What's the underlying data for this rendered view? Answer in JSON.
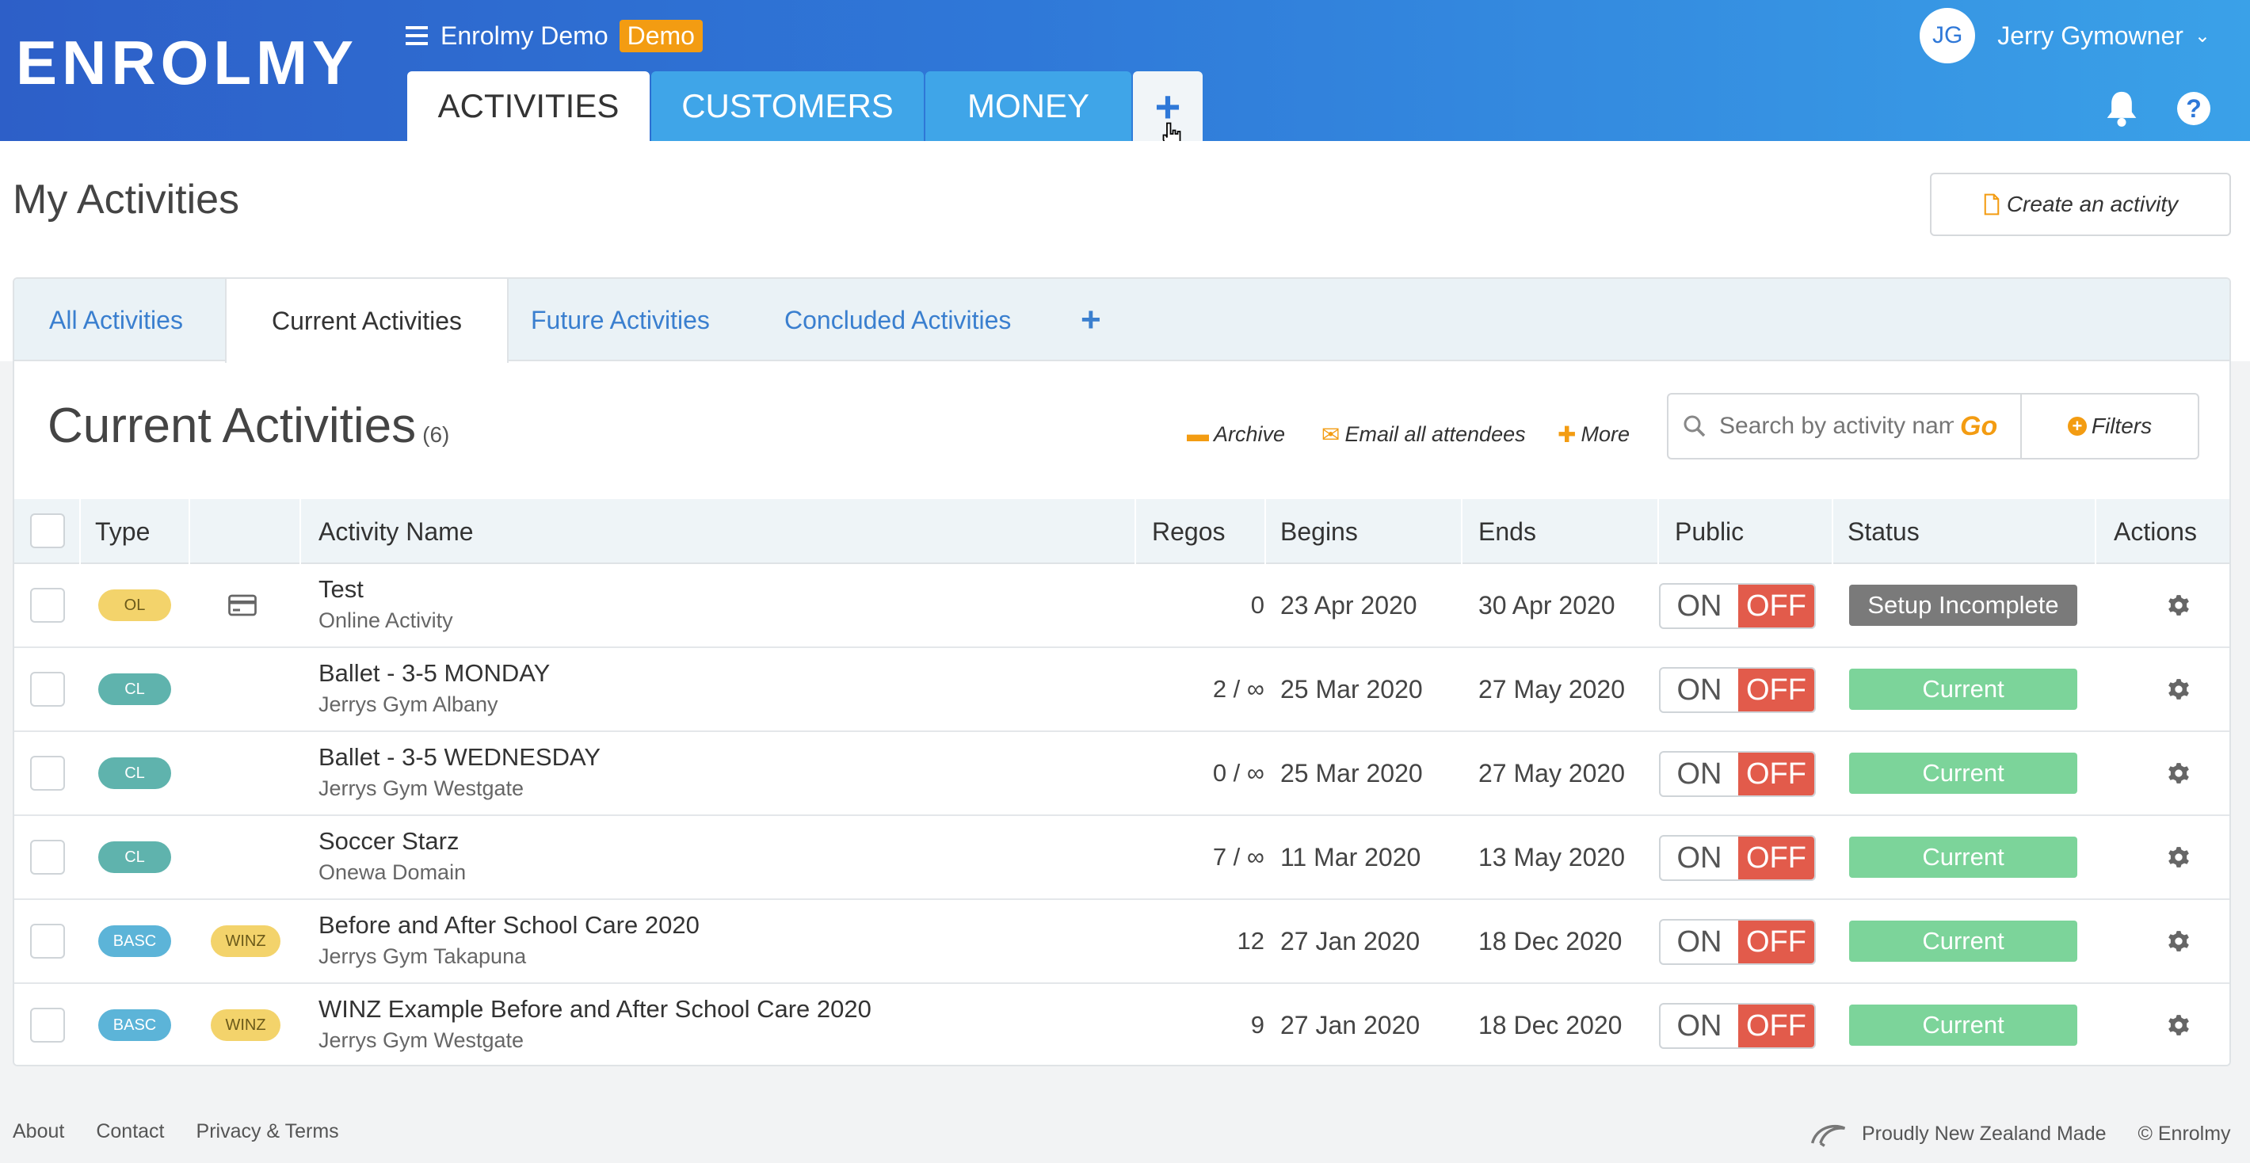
{
  "header": {
    "logo_text": "ENROLMY",
    "org_name": "Enrolmy Demo",
    "org_badge": "Demo",
    "tabs": [
      {
        "label": "ACTIVITIES"
      },
      {
        "label": "CUSTOMERS"
      },
      {
        "label": "MONEY"
      },
      {
        "label": "+"
      }
    ],
    "user": {
      "initials": "JG",
      "name": "Jerry Gymowner"
    },
    "help_label": "?"
  },
  "page": {
    "title": "My Activities",
    "create_button": "Create an activity"
  },
  "sub_tabs": [
    {
      "label": "All Activities"
    },
    {
      "label": "Current Activities"
    },
    {
      "label": "Future Activities"
    },
    {
      "label": "Concluded Activities"
    },
    {
      "label": "+"
    }
  ],
  "section": {
    "title": "Current Activities",
    "count": "(6)",
    "archive": "Archive",
    "email": "Email all attendees",
    "more": "More",
    "search_placeholder": "Search by activity name",
    "go": "Go",
    "filters": "Filters"
  },
  "table": {
    "headers": [
      "Type",
      "Activity Name",
      "Regos",
      "Begins",
      "Ends",
      "Public",
      "Status",
      "Actions"
    ],
    "rows": [
      {
        "type": "OL",
        "winz": "",
        "name": "Test",
        "location": "Online Activity",
        "regos": "0",
        "begins": "23 Apr 2020",
        "ends": "30 Apr 2020",
        "on": "ON",
        "off": "OFF",
        "status": "Setup Incomplete"
      },
      {
        "type": "CL",
        "winz": "",
        "name": "Ballet - 3-5 MONDAY",
        "location": "Jerrys Gym Albany",
        "regos": "2 / ∞",
        "begins": "25 Mar 2020",
        "ends": "27 May 2020",
        "on": "ON",
        "off": "OFF",
        "status": "Current"
      },
      {
        "type": "CL",
        "winz": "",
        "name": "Ballet - 3-5 WEDNESDAY",
        "location": "Jerrys Gym Westgate",
        "regos": "0 / ∞",
        "begins": "25 Mar 2020",
        "ends": "27 May 2020",
        "on": "ON",
        "off": "OFF",
        "status": "Current"
      },
      {
        "type": "CL",
        "winz": "",
        "name": "Soccer Starz",
        "location": "Onewa Domain",
        "regos": "7 / ∞",
        "begins": "11 Mar 2020",
        "ends": "13 May 2020",
        "on": "ON",
        "off": "OFF",
        "status": "Current"
      },
      {
        "type": "BASC",
        "winz": "WINZ",
        "name": "Before and After School Care 2020",
        "location": "Jerrys Gym Takapuna",
        "regos": "12",
        "begins": "27 Jan 2020",
        "ends": "18 Dec 2020",
        "on": "ON",
        "off": "OFF",
        "status": "Current"
      },
      {
        "type": "BASC",
        "winz": "WINZ",
        "name": "WINZ Example Before and After School Care 2020",
        "location": "Jerrys Gym Westgate",
        "regos": "9",
        "begins": "27 Jan 2020",
        "ends": "18 Dec 2020",
        "on": "ON",
        "off": "OFF",
        "status": "Current"
      }
    ]
  },
  "footer": {
    "links": [
      "About",
      "Contact",
      "Privacy & Terms"
    ],
    "made": "Proudly New Zealand Made",
    "copyright": "© Enrolmy"
  },
  "colors": {
    "accent": "#3a7fcf",
    "orange": "#f39c12",
    "current": "#7cd49a",
    "setup": "#7a7a7a",
    "off": "#e25b4b"
  }
}
